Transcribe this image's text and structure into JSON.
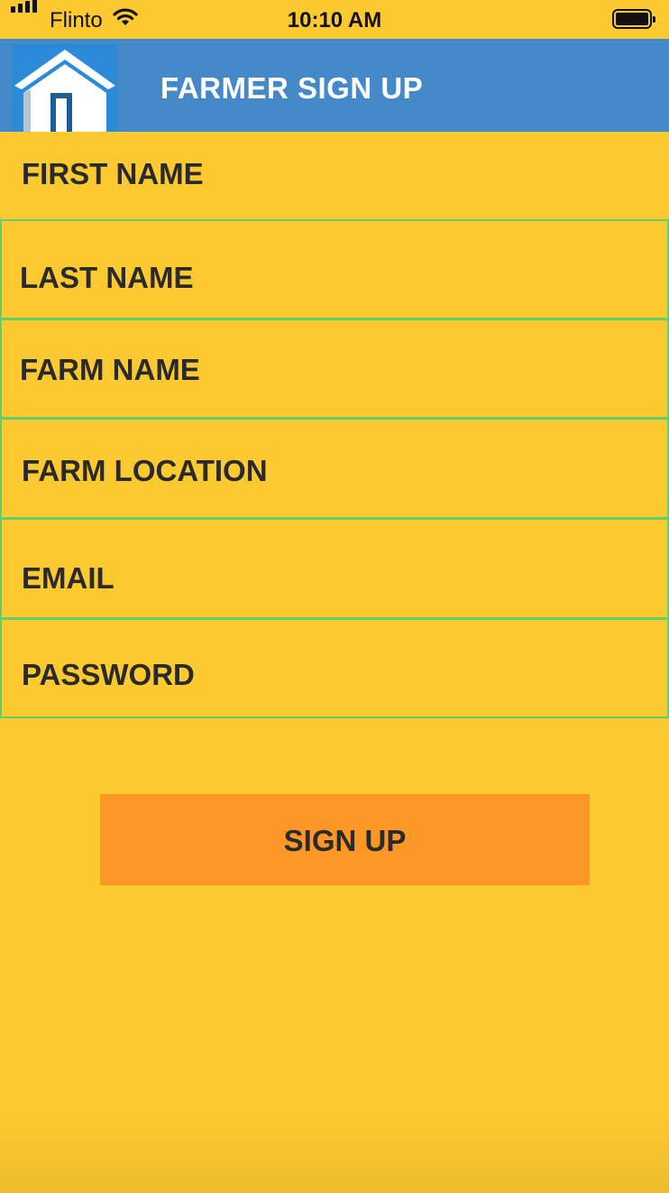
{
  "status_bar": {
    "carrier": "Flinto",
    "time": "10:10 AM",
    "icons": [
      "signal-icon",
      "wifi-icon",
      "battery-icon"
    ]
  },
  "header": {
    "title": "FARMER SIGN UP",
    "icon": "home-icon"
  },
  "form": {
    "fields": [
      {
        "label": "FIRST NAME"
      },
      {
        "label": "LAST NAME"
      },
      {
        "label": "FARM NAME"
      },
      {
        "label": "FARM LOCATION"
      },
      {
        "label": "EMAIL"
      },
      {
        "label": "PASSWORD"
      }
    ],
    "submit_label": "SIGN UP"
  },
  "colors": {
    "background": "#FCCA30",
    "header": "#4589C9",
    "field_border": "#5ED16C",
    "button": "#FB9627",
    "text": "#2A2A2A"
  }
}
